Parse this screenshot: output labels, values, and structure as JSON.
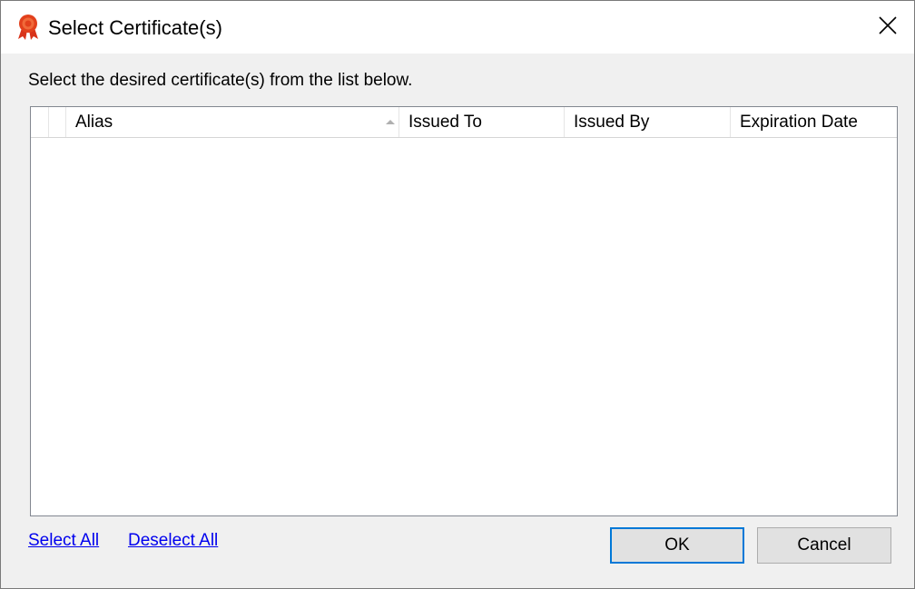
{
  "window": {
    "title": "Select Certificate(s)",
    "icon": "certificate-ribbon-icon",
    "close_icon": "close-icon"
  },
  "instruction": "Select the desired certificate(s) from the list below.",
  "table": {
    "columns": [
      "",
      "",
      "Alias",
      "Issued To",
      "Issued By",
      "Expiration Date"
    ],
    "sort_column": "Alias",
    "sort_direction": "ascending",
    "rows": []
  },
  "links": {
    "select_all": "Select All",
    "deselect_all": "Deselect All"
  },
  "buttons": {
    "ok": "OK",
    "cancel": "Cancel"
  },
  "colors": {
    "link": "#0000ee",
    "default_button_border": "#0078d7",
    "icon_red": "#e2401c"
  }
}
